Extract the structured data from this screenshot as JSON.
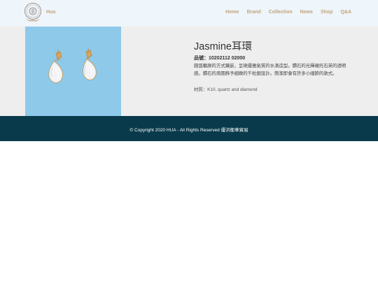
{
  "header": {
    "brand": "Hua",
    "nav": [
      "Home",
      "Brand",
      "Collection",
      "News",
      "Shop",
      "Q&A"
    ]
  },
  "product": {
    "title": "Jasmine耳環",
    "code_label": "品號：",
    "code": "10202112 02000",
    "description": "圓弧輪廓的方式鑲嵌，呈現優雅氣質的水滴造型。鑽石的光輝襯托石英的透明感。鑽石的周圍飾予細緻的千粒銀設計。簡潔即會有許多小細節的款式。",
    "material": "材質：K10, quartz and diamond"
  },
  "footer": {
    "copyright": "© Copyright 2020 HUA - All Rights Reserved 優洪衡華貿易"
  }
}
